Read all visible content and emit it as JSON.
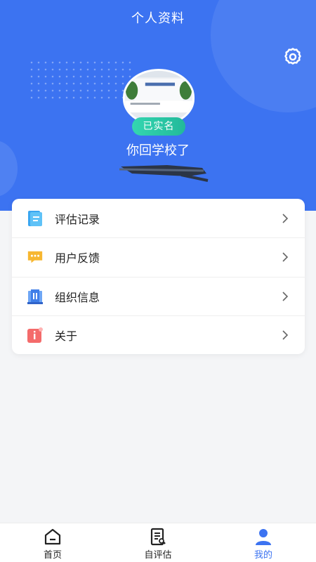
{
  "header": {
    "title": "个人资料",
    "settings_icon": "gear-icon"
  },
  "profile": {
    "verified_badge": "已实名",
    "username": "你回学校了"
  },
  "menu": {
    "items": [
      {
        "label": "评估记录",
        "icon": "document-icon"
      },
      {
        "label": "用户反馈",
        "icon": "chat-icon"
      },
      {
        "label": "组织信息",
        "icon": "building-icon"
      },
      {
        "label": "关于",
        "icon": "info-icon"
      }
    ]
  },
  "tabbar": {
    "items": [
      {
        "label": "首页",
        "icon": "home-icon",
        "active": false
      },
      {
        "label": "自评估",
        "icon": "self-assess-icon",
        "active": false
      },
      {
        "label": "我的",
        "icon": "user-icon",
        "active": true
      }
    ]
  },
  "colors": {
    "primary": "#3c73f1",
    "badge": "#22b99a"
  }
}
